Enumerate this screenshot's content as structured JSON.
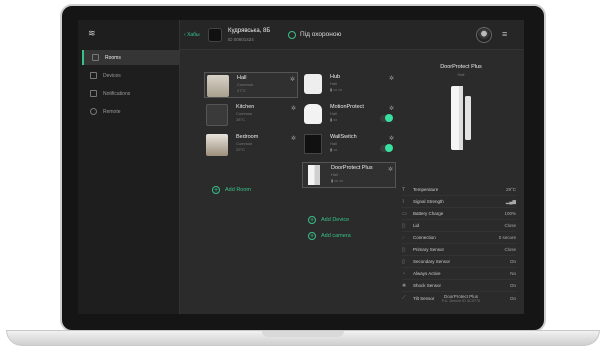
{
  "sidebar": {
    "items": [
      {
        "label": "Rooms",
        "active": true
      },
      {
        "label": "Devices",
        "active": false
      },
      {
        "label": "Notifications",
        "active": false
      },
      {
        "label": "Remote",
        "active": false
      }
    ]
  },
  "header": {
    "back_label": "Хабы",
    "hub_name": "Кудрявська, 8Б",
    "hub_id": "ID 00601424",
    "security_status": "Під охороною"
  },
  "rooms": [
    {
      "name": "Hall",
      "sub1": "Common",
      "sub2": "27°C"
    },
    {
      "name": "Kitchen",
      "sub1": "Common",
      "sub2": "28°C"
    },
    {
      "name": "Bedroom",
      "sub1": "Common",
      "sub2": "29°C"
    }
  ],
  "add_room_label": "Add Room",
  "devices": [
    {
      "name": "Hub",
      "room": "Hall"
    },
    {
      "name": "MotionProtect",
      "room": "Hall"
    },
    {
      "name": "WallSwitch",
      "room": "Hall"
    },
    {
      "name": "DoorProtect Plus",
      "room": "Hall"
    }
  ],
  "add_device_label": "Add Device",
  "add_camera_label": "Add camera",
  "panel": {
    "title": "DoorProtect Plus",
    "room": "Hall",
    "properties": [
      {
        "icon": "thermometer-icon",
        "label": "Temperature",
        "value": "29°C"
      },
      {
        "icon": "signal-icon",
        "label": "Signal Strength",
        "value": ""
      },
      {
        "icon": "battery-icon",
        "label": "Battery Charge",
        "value": "100%"
      },
      {
        "icon": "lid-icon",
        "label": "Lid",
        "value": "Close"
      },
      {
        "icon": "connection-icon",
        "label": "Connection",
        "value": "0 secure"
      },
      {
        "icon": "sensor-icon",
        "label": "Primary Sensor",
        "value": "Close"
      },
      {
        "icon": "sensor-icon",
        "label": "Secondary Sensor",
        "value": "On"
      },
      {
        "icon": "power-icon",
        "label": "Always Active",
        "value": "No"
      },
      {
        "icon": "shock-icon",
        "label": "Shock Sensor",
        "value": "On"
      },
      {
        "icon": "tilt-icon",
        "label": "Tilt Sensor",
        "value": "On"
      }
    ],
    "footer_name": "DoorProtect Plus",
    "footer_id": "P.A. Device ID 3C0770"
  },
  "colors": {
    "accent": "#38c18a",
    "toggle": "#38e0a0"
  }
}
